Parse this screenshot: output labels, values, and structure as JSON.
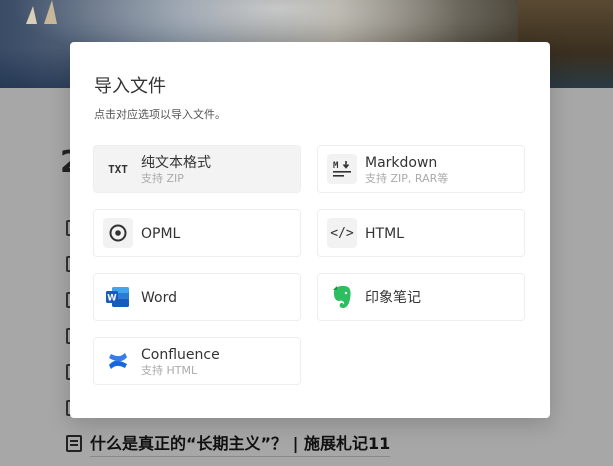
{
  "dialog": {
    "title": "导入文件",
    "subtitle": "点击对应选项以导入文件。"
  },
  "options": [
    {
      "label": "纯文本格式",
      "sub": "支持 ZIP",
      "icon": "txt-icon",
      "selected": true
    },
    {
      "label": "Markdown",
      "sub": "支持 ZIP, RAR等",
      "icon": "markdown-icon",
      "selected": false
    },
    {
      "label": "OPML",
      "sub": "",
      "icon": "opml-icon",
      "selected": false
    },
    {
      "label": "HTML",
      "sub": "",
      "icon": "html-code-icon",
      "selected": false
    },
    {
      "label": "Word",
      "sub": "",
      "icon": "word-icon",
      "selected": false
    },
    {
      "label": "印象笔记",
      "sub": "",
      "icon": "evernote-icon",
      "selected": false
    },
    {
      "label": "Confluence",
      "sub": "支持 HTML",
      "icon": "confluence-icon",
      "selected": false
    }
  ],
  "icon_glyphs": {
    "txt": "TXT",
    "markdown": "M↓",
    "html": "</>"
  },
  "background": {
    "big_char": "2",
    "article_title": "什么是真正的“长期主义”？ | 施展札记11"
  },
  "colors": {
    "word_blue": "#185abd",
    "evernote_green": "#2dbe60",
    "confluence_blue": "#1868db"
  }
}
